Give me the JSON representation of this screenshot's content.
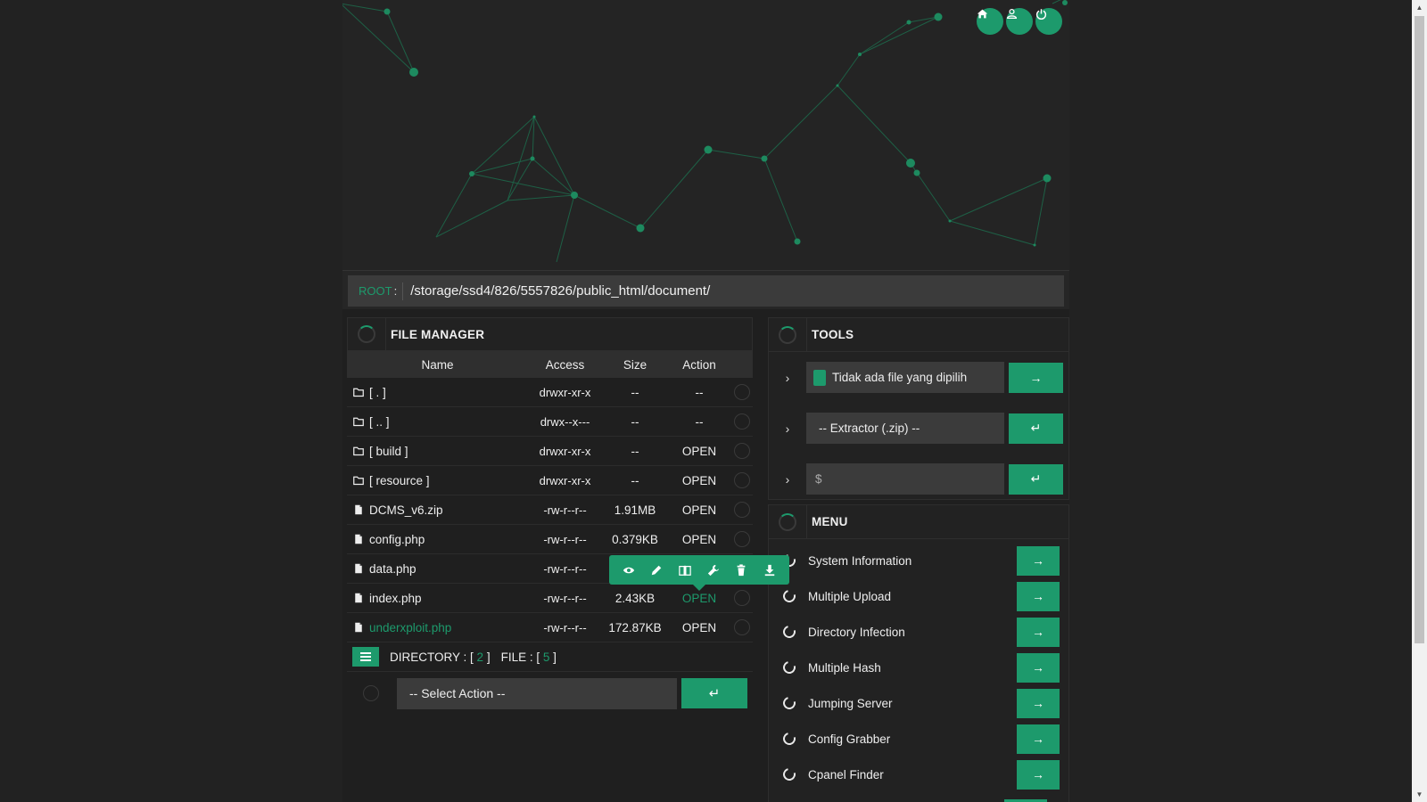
{
  "colors": {
    "accent": "#1d9a6c",
    "background": "#222222",
    "field": "#3b3b3b"
  },
  "top_buttons": [
    {
      "icon": "home-icon"
    },
    {
      "icon": "user-icon"
    },
    {
      "icon": "power-icon"
    }
  ],
  "root": {
    "label": "ROOT",
    "colon": ":",
    "path": "/storage/ssd4/826/5557826/public_html/document/"
  },
  "file_manager": {
    "title": "FILE MANAGER",
    "columns": {
      "name": "Name",
      "access": "Access",
      "size": "Size",
      "action": "Action"
    },
    "rows": [
      {
        "type": "folder",
        "name": "[ . ]",
        "access": "drwxr-xr-x",
        "size": "--",
        "action": "--"
      },
      {
        "type": "folder",
        "name": "[ .. ]",
        "access": "drwx--x---",
        "size": "--",
        "action": "--"
      },
      {
        "type": "folder",
        "name": "[ build ]",
        "access": "drwxr-xr-x",
        "size": "--",
        "action": "OPEN"
      },
      {
        "type": "folder",
        "name": "[ resource ]",
        "access": "drwxr-xr-x",
        "size": "--",
        "action": "OPEN"
      },
      {
        "type": "file",
        "name": "DCMS_v6.zip",
        "access": "-rw-r--r--",
        "size": "1.91MB",
        "action": "OPEN"
      },
      {
        "type": "file",
        "name": "config.php",
        "access": "-rw-r--r--",
        "size": "0.379KB",
        "action": "OPEN"
      },
      {
        "type": "file",
        "name": "data.php",
        "access": "-rw-r--r--",
        "size": "",
        "action": ""
      },
      {
        "type": "file",
        "name": "index.php",
        "access": "-rw-r--r--",
        "size": "2.43KB",
        "action": "OPEN"
      },
      {
        "type": "file",
        "name": "underxploit.php",
        "access": "-rw-r--r--",
        "size": "172.87KB",
        "action": "OPEN"
      }
    ],
    "footer": {
      "dir_label": "DIRECTORY : [",
      "dir_count": "2",
      "dir_close": "]",
      "file_label": "FILE : [",
      "file_count": "5",
      "file_close": "]"
    },
    "select_action": "-- Select Action --",
    "go_symbol": "↵"
  },
  "tooltip_actions": [
    "eye-icon",
    "pencil-icon",
    "book-icon",
    "wrench-icon",
    "trash-icon",
    "download-icon"
  ],
  "tools": {
    "title": "TOOLS",
    "rows": [
      {
        "chev": "›",
        "text": "Tidak ada file yang dipilih",
        "btn": "→"
      },
      {
        "chev": "›",
        "text": "-- Extractor (.zip) --",
        "btn": "↵"
      },
      {
        "chev": "›",
        "text": "$",
        "btn": "↵"
      }
    ]
  },
  "menu": {
    "title": "MENU",
    "items": [
      {
        "label": "System Information",
        "btn": "→"
      },
      {
        "label": "Multiple Upload",
        "btn": "→"
      },
      {
        "label": "Directory Infection",
        "btn": "→"
      },
      {
        "label": "Multiple Hash",
        "btn": "→"
      },
      {
        "label": "Jumping Server",
        "btn": "→"
      },
      {
        "label": "Config Grabber",
        "btn": "→"
      },
      {
        "label": "Cpanel Finder",
        "btn": "→"
      }
    ]
  }
}
